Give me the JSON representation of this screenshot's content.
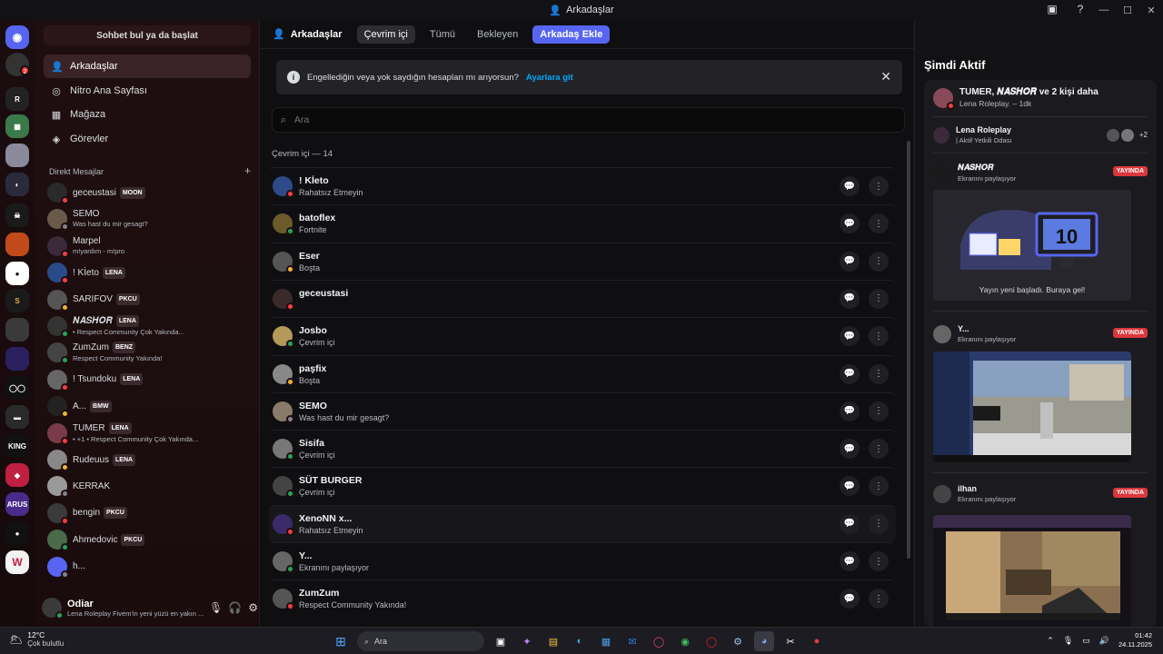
{
  "window": {
    "title": "Arkadaşlar"
  },
  "colors": {
    "accent": "#5865f2",
    "live": "#da373c",
    "online": "#23a55a",
    "dnd": "#f23f43",
    "idle": "#f0b232"
  },
  "rail": {
    "badge_count": "2"
  },
  "dm_column": {
    "search_label": "Sohbet bul ya da başlat",
    "nav": [
      {
        "label": "Arkadaşlar",
        "icon": "friends-icon"
      },
      {
        "label": "Nitro Ana Sayfası",
        "icon": "nitro-icon"
      },
      {
        "label": "Mağaza",
        "icon": "shop-icon"
      },
      {
        "label": "Görevler",
        "icon": "quests-icon"
      }
    ],
    "dm_header": "Direkt Mesajlar",
    "dm_add": "+",
    "dms": [
      {
        "name": "geceustasi",
        "tag": "MOON",
        "sub": "",
        "status": "dnd"
      },
      {
        "name": "SEMO",
        "tag": "",
        "sub": "Was hast du mir gesagt?",
        "status": "off"
      },
      {
        "name": "Marpel",
        "tag": "",
        "sub": "m!yardım - m!pro",
        "status": "dnd"
      },
      {
        "name": "! Kİeto",
        "tag": "LENA",
        "sub": "",
        "status": "dnd"
      },
      {
        "name": "SARIFOV",
        "tag": "PKCU",
        "sub": "",
        "status": "idle"
      },
      {
        "name": "𝑵𝑨𝑺𝑯𝑶𝑹",
        "tag": "LENA",
        "sub": "• Respect Community Çok Yakında...",
        "status": "on"
      },
      {
        "name": "ZumZum",
        "tag": "BENZ",
        "sub": "Respect Community Yakında!",
        "status": "on"
      },
      {
        "name": "! Tsundoku",
        "tag": "LENA",
        "sub": "",
        "status": "dnd"
      },
      {
        "name": "A...",
        "tag": "BMW",
        "sub": "",
        "status": "idle"
      },
      {
        "name": "TUMER",
        "tag": "LENA",
        "sub": "• +1 • Respect Community Çok Yakında...",
        "status": "dnd"
      },
      {
        "name": "Rudeuus",
        "tag": "LENA",
        "sub": "",
        "status": "idle"
      },
      {
        "name": "KERRAK",
        "tag": "",
        "sub": "",
        "status": "off"
      },
      {
        "name": "bengin",
        "tag": "PKCU",
        "sub": "",
        "status": "dnd"
      },
      {
        "name": "Ahmedovic",
        "tag": "PKCU",
        "sub": "",
        "status": "on"
      },
      {
        "name": "h...",
        "tag": "",
        "sub": "",
        "status": "off"
      }
    ],
    "user": {
      "name": "Odiar",
      "sub": "Lena Roleplay Fivem'in yeni yüzü en yakın ..."
    }
  },
  "main": {
    "title": "Arkadaşlar",
    "tabs": [
      "Çevrim içi",
      "Tümü",
      "Bekleyen"
    ],
    "add_friend": "Arkadaş Ekle",
    "notice": {
      "text": "Engellediğin veya yok saydığın hesapları mı arıyorsun?",
      "link": "Ayarlara git"
    },
    "search_placeholder": "Ara",
    "count_label": "Çevrim içi — 14",
    "friends": [
      {
        "name": "! Kİeto",
        "sub": "Rahatsız Etmeyin",
        "status": "dnd",
        "color": "#2d4a8a"
      },
      {
        "name": "batoflex",
        "sub": "Fortnite",
        "status": "on",
        "color": "#6b5a2a"
      },
      {
        "name": "Eser",
        "sub": "Boşta",
        "status": "idle",
        "color": "#555"
      },
      {
        "name": "geceustasi",
        "sub": "",
        "status": "dnd",
        "color": "#3a2a2a"
      },
      {
        "name": "Josbo",
        "sub": "Çevrim içi",
        "status": "on",
        "color": "#b39a5a"
      },
      {
        "name": "paşfix",
        "sub": "Boşta",
        "status": "idle",
        "color": "#888"
      },
      {
        "name": "SEMO",
        "sub": "Was hast du mir gesagt?",
        "status": "off",
        "color": "#8a7a6a"
      },
      {
        "name": "Sisifa",
        "sub": "Çevrim içi",
        "status": "on",
        "color": "#777"
      },
      {
        "name": "SÜT BURGER",
        "sub": "Çevrim içi",
        "status": "on",
        "color": "#444"
      },
      {
        "name": "XenoNN x...",
        "sub": "Rahatsız Etmeyin",
        "status": "dnd",
        "color": "#3a2a6a"
      },
      {
        "name": "Y...",
        "sub": "Ekranını paylaşıyor",
        "status": "on",
        "color": "#666"
      },
      {
        "name": "ZumZum",
        "sub": "Respect Community Yakında!",
        "status": "dnd",
        "color": "#555"
      }
    ]
  },
  "active_now": {
    "title": "Şimdi Aktif",
    "group": {
      "name": "TUMER, 𝑵𝑨𝑺𝑯𝑶𝑹 ve 2 kişi daha",
      "sub": "Lena Roleplay. – 1dk"
    },
    "voice": {
      "name": "Lena Roleplay",
      "sub": "| Aktif Yetkili Odası",
      "extra": "+2"
    },
    "live_label": "YAYINDA",
    "streams": [
      {
        "name": "𝑵𝑨𝑺𝑯𝑶𝑹",
        "sub": "Ekranını paylaşıyor",
        "thumb_text": "Yayın yeni başladı. Buraya gel!",
        "big_number": "10"
      },
      {
        "name": "Y...",
        "sub": "Ekranını paylaşıyor"
      },
      {
        "name": "ilhan",
        "sub": "Ekranını paylaşıyor"
      }
    ]
  },
  "taskbar": {
    "temp": "12°C",
    "condition": "Çok bulutlu",
    "search": "Ara",
    "time": "01:42",
    "date": "24.11.2025"
  }
}
